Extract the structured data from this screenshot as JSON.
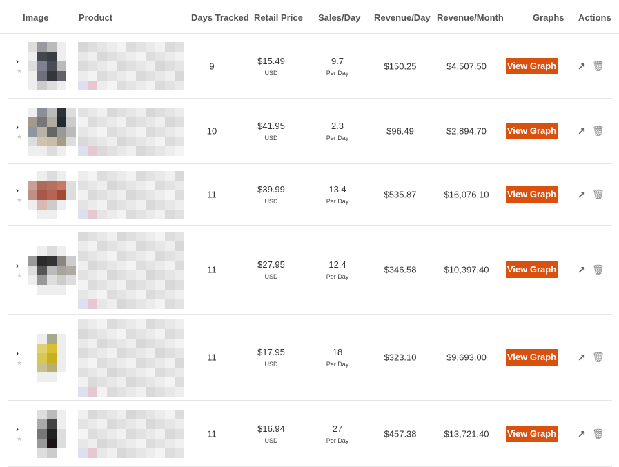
{
  "headers": {
    "image": "Image",
    "product": "Product",
    "days": "Days Tracked",
    "price": "Retail Price",
    "sales": "Sales/Day",
    "rev_day": "Revenue/Day",
    "rev_month": "Revenue/Month",
    "graphs": "Graphs",
    "actions": "Actions"
  },
  "accent": "#d9500f",
  "icons": {
    "expand": "chevron-right-icon",
    "favorite": "star-icon",
    "open": "external-link-icon",
    "delete": "trash-icon"
  },
  "rows": [
    {
      "days": "9",
      "price": "$15.49",
      "currency": "USD",
      "sales": "9.7",
      "per": "Per Day",
      "rev_day": "$150.25",
      "rev_month": "$4,507.50",
      "graph_label": "View Graph"
    },
    {
      "days": "10",
      "price": "$41.95",
      "currency": "USD",
      "sales": "2.3",
      "per": "Per Day",
      "rev_day": "$96.49",
      "rev_month": "$2,894.70",
      "graph_label": "View Graph"
    },
    {
      "days": "11",
      "price": "$39.99",
      "currency": "USD",
      "sales": "13.4",
      "per": "Per Day",
      "rev_day": "$535.87",
      "rev_month": "$16,076.10",
      "graph_label": "View Graph"
    },
    {
      "days": "11",
      "price": "$27.95",
      "currency": "USD",
      "sales": "12.4",
      "per": "Per Day",
      "rev_day": "$346.58",
      "rev_month": "$10,397.40",
      "graph_label": "View Graph"
    },
    {
      "days": "11",
      "price": "$17.95",
      "currency": "USD",
      "sales": "18",
      "per": "Per Day",
      "rev_day": "$323.10",
      "rev_month": "$9,693.00",
      "graph_label": "View Graph"
    },
    {
      "days": "11",
      "price": "$16.94",
      "currency": "USD",
      "sales": "27",
      "per": "Per Day",
      "rev_day": "$457.38",
      "rev_month": "$13,721.40",
      "graph_label": "View Graph"
    }
  ]
}
